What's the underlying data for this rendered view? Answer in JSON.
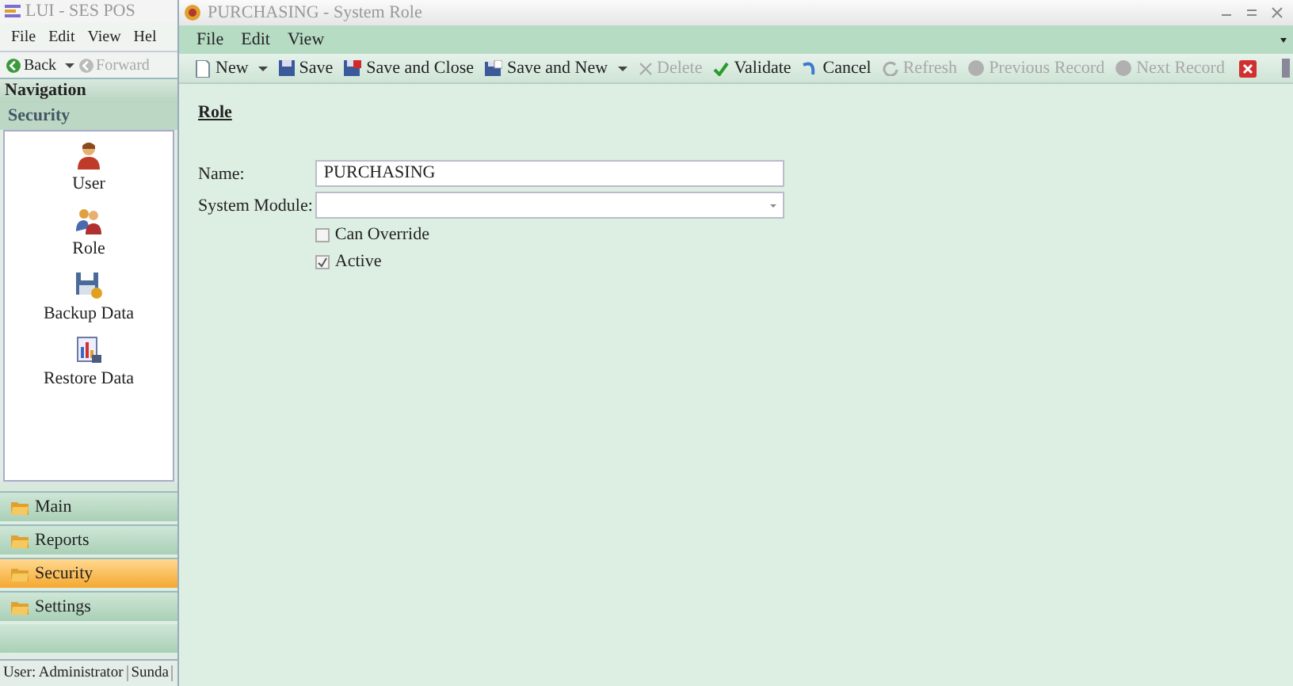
{
  "main_window": {
    "title": "LUI - SES POS",
    "menu": [
      "File",
      "Edit",
      "View",
      "Hel"
    ],
    "toolbar": [
      {
        "label": "Back",
        "disabled": false,
        "dropdown": true
      },
      {
        "label": "Forward",
        "disabled": true,
        "dropdown": false
      }
    ],
    "navigation": {
      "title": "Navigation",
      "group_title": "Security",
      "items": [
        {
          "label": "User"
        },
        {
          "label": "Role"
        },
        {
          "label": "Backup Data"
        },
        {
          "label": "Restore Data"
        }
      ],
      "groups": [
        {
          "label": "Main",
          "selected": false
        },
        {
          "label": "Reports",
          "selected": false
        },
        {
          "label": "Security",
          "selected": true
        },
        {
          "label": "Settings",
          "selected": false
        }
      ]
    },
    "status_bar": [
      "User: Administrator",
      "Sunda"
    ]
  },
  "role_window": {
    "title": "PURCHASING - System Role",
    "menu": [
      "File",
      "Edit",
      "View"
    ],
    "toolbar": [
      {
        "label": "New",
        "disabled": false,
        "dropdown": true
      },
      {
        "label": "Save",
        "disabled": false,
        "dropdown": false
      },
      {
        "label": "Save and Close",
        "disabled": false,
        "dropdown": false
      },
      {
        "label": "Save and New",
        "disabled": false,
        "dropdown": true
      },
      {
        "label": "Delete",
        "disabled": true,
        "dropdown": false
      },
      {
        "label": "Validate",
        "disabled": false,
        "dropdown": false
      },
      {
        "label": "Cancel",
        "disabled": false,
        "dropdown": false
      },
      {
        "label": "Refresh",
        "disabled": true,
        "dropdown": false
      },
      {
        "label": "Previous Record",
        "disabled": true,
        "dropdown": false
      },
      {
        "label": "Next Record",
        "disabled": true,
        "dropdown": false
      }
    ],
    "heading": "Role",
    "fields": [
      {
        "label": "Name:",
        "kind": "text",
        "value": "PURCHASING"
      },
      {
        "label": "System Module:",
        "kind": "select"
      }
    ],
    "checkboxes": [
      {
        "label": "Can Override",
        "checked": false
      },
      {
        "label": "Active",
        "checked": true
      }
    ]
  }
}
